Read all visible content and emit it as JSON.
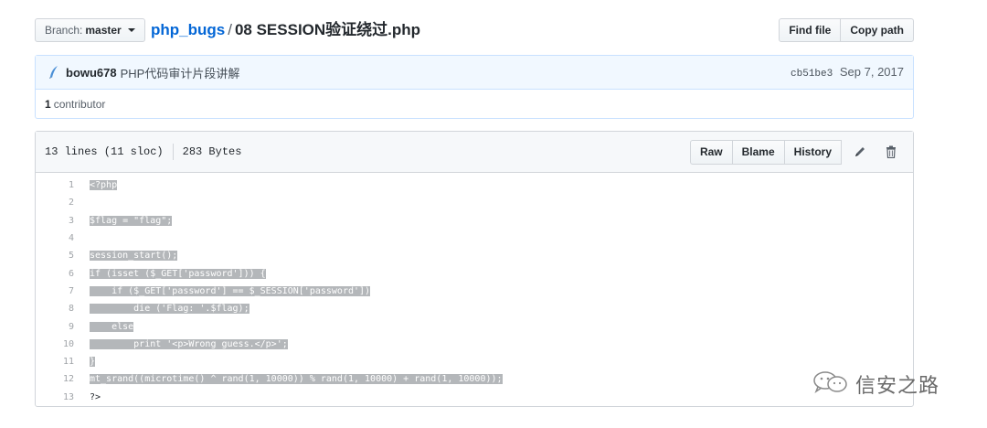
{
  "top": {
    "branch_prefix": "Branch:",
    "branch_name": "master",
    "repo": "php_bugs",
    "path_sep": "/",
    "filename": "08 SESSION验证绕过.php",
    "find_file": "Find file",
    "copy_path": "Copy path"
  },
  "commit": {
    "author": "bowu678",
    "message": "PHP代码审计片段讲解",
    "sha": "cb51be3",
    "date": "Sep 7, 2017"
  },
  "contributors": {
    "count": "1",
    "label": "contributor"
  },
  "file": {
    "lines_info": "13 lines (11 sloc)",
    "size": "283 Bytes",
    "raw": "Raw",
    "blame": "Blame",
    "history": "History"
  },
  "code_lines": [
    {
      "num": "1",
      "text": "<?php",
      "highlight": true
    },
    {
      "num": "2",
      "text": "",
      "highlight": false
    },
    {
      "num": "3",
      "text": "$flag = \"flag\";",
      "highlight": true
    },
    {
      "num": "4",
      "text": "",
      "highlight": false
    },
    {
      "num": "5",
      "text": "session_start();",
      "highlight": true
    },
    {
      "num": "6",
      "text": "if (isset ($_GET['password'])) {",
      "highlight": true
    },
    {
      "num": "7",
      "text": "    if ($_GET['password'] == $_SESSION['password'])",
      "highlight": true
    },
    {
      "num": "8",
      "text": "        die ('Flag: '.$flag);",
      "highlight": true
    },
    {
      "num": "9",
      "text": "    else",
      "highlight": true
    },
    {
      "num": "10",
      "text": "        print '<p>Wrong guess.</p>';",
      "highlight": true
    },
    {
      "num": "11",
      "text": "}",
      "highlight": true
    },
    {
      "num": "12",
      "text": "mt_srand((microtime() ^ rand(1, 10000)) % rand(1, 10000) + rand(1, 10000));",
      "highlight": true
    },
    {
      "num": "13",
      "text": "?>",
      "highlight": false
    }
  ],
  "watermark": {
    "text": "信安之路"
  },
  "colors": {
    "link": "#0366d6",
    "commit_bg": "#f1f8ff",
    "code_highlight": "#b4b7ba"
  }
}
